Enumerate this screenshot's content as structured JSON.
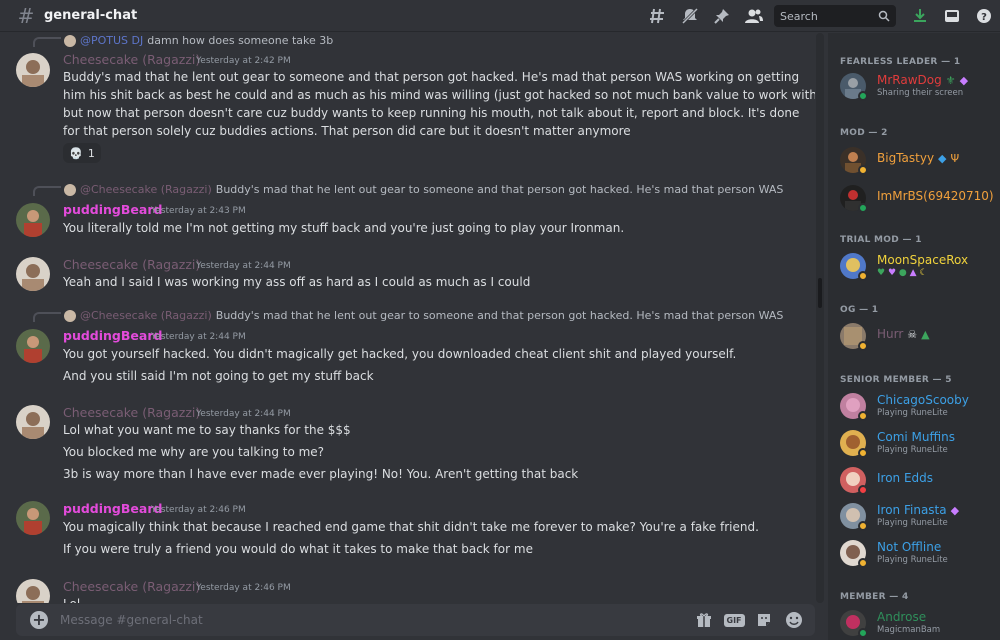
{
  "header": {
    "channel": "general-chat",
    "search_placeholder": "Search",
    "icons": [
      "threads-icon",
      "mute-icon",
      "pin-icon",
      "members-icon",
      "search-icon",
      "download-icon",
      "inbox-icon",
      "help-icon"
    ]
  },
  "messages": {
    "m1": {
      "reply_name": "@POTUS DJ",
      "reply_text": "damn how does someone take 3b",
      "author": "Cheesecake (Ragazzi)",
      "time": "Yesterday at 2:42 PM",
      "lines": [
        "Buddy's mad that he lent out gear to someone and that person got hacked. He's mad that person WAS working on getting",
        "him his shit back as best he could and as much as his mind was willing (just got hacked so not much bank value to work with)",
        "but now that person doesn't care cuz buddy wants to keep running his mouth, not talk about it, report and block. It's done",
        "for that person solely cuz buddies actions. That person did care but it doesn't matter anymore"
      ],
      "reaction_emoji": "💀",
      "reaction_count": "1"
    },
    "m2": {
      "reply_name": "@Cheesecake (Ragazzi)",
      "reply_text": "Buddy's mad that he lent out gear to someone and that person got hacked. He's mad that person WAS working on g",
      "author": "puddingBeard",
      "time": "Yesterday at 2:43 PM",
      "lines": [
        "You literally told me I'm not getting my stuff back and you're just going to play your Ironman."
      ]
    },
    "m3": {
      "author": "Cheesecake (Ragazzi)",
      "time": "Yesterday at 2:44 PM",
      "lines": [
        "Yeah and I said I was working my ass off as hard as I could as much as I could"
      ]
    },
    "m4": {
      "reply_name": "@Cheesecake (Ragazzi)",
      "reply_text": "Buddy's mad that he lent out gear to someone and that person got hacked. He's mad that person WAS working on g",
      "author": "puddingBeard",
      "time": "Yesterday at 2:44 PM",
      "lines": [
        "You got yourself hacked. You didn't magically get hacked, you downloaded cheat client shit and played yourself.",
        "And you still said I'm not going to get my stuff back"
      ]
    },
    "m5": {
      "author": "Cheesecake (Ragazzi)",
      "time": "Yesterday at 2:44 PM",
      "lines": [
        "Lol what you want me to say thanks for the $$$",
        "You blocked me why are you talking to me?",
        "3b is way more than I have ever made ever playing! No! You. Aren't getting that back"
      ]
    },
    "m6": {
      "author": "puddingBeard",
      "time": "Yesterday at 2:46 PM",
      "lines": [
        "You magically think that because I reached end game that shit didn't take me forever to make? You're a fake friend.",
        "If you were truly a friend you would do what it takes to make that back for me"
      ]
    },
    "m7": {
      "author": "Cheesecake (Ragazzi)",
      "time": "Yesterday at 2:46 PM",
      "lines": [
        "Lol ..."
      ]
    }
  },
  "composer": {
    "placeholder": "Message #general-chat"
  },
  "members": {
    "groups": {
      "leader": "FEARLESS LEADER — 1",
      "mod": "MOD — 2",
      "trial": "TRIAL MOD — 1",
      "og": "OG — 1",
      "senior": "SENIOR MEMBER — 5",
      "member": "MEMBER — 4"
    },
    "list": {
      "mrrawdog": {
        "name": "MrRawDog",
        "sub": "Sharing their screen",
        "color": "#e03c3c"
      },
      "bigtastyy": {
        "name": "BigTastyy",
        "color": "#f0a03c"
      },
      "immrbs": {
        "name": "ImMrBS(69420710)",
        "color": "#f0a03c"
      },
      "moonspacerox": {
        "name": "MoonSpaceRox",
        "color": "#f0d23c"
      },
      "hurr": {
        "name": "Hurr",
        "color": "#7a5d74"
      },
      "chicagoscooby": {
        "name": "ChicagoScooby",
        "sub": "Playing RuneLite",
        "color": "#3ca0e6"
      },
      "comimuffins": {
        "name": "Comi Muffins",
        "sub": "Playing RuneLite",
        "color": "#3ca0e6"
      },
      "ironedds": {
        "name": "Iron Edds",
        "color": "#3ca0e6"
      },
      "ironfinasta": {
        "name": "Iron Finasta",
        "sub": "Playing RuneLite",
        "color": "#3ca0e6"
      },
      "notoffline": {
        "name": "Not Offline",
        "sub": "Playing RuneLite",
        "color": "#3ca0e6"
      },
      "androse": {
        "name": "Androse",
        "sub": "MagicmanBam",
        "color": "#2f8f5b"
      }
    }
  }
}
